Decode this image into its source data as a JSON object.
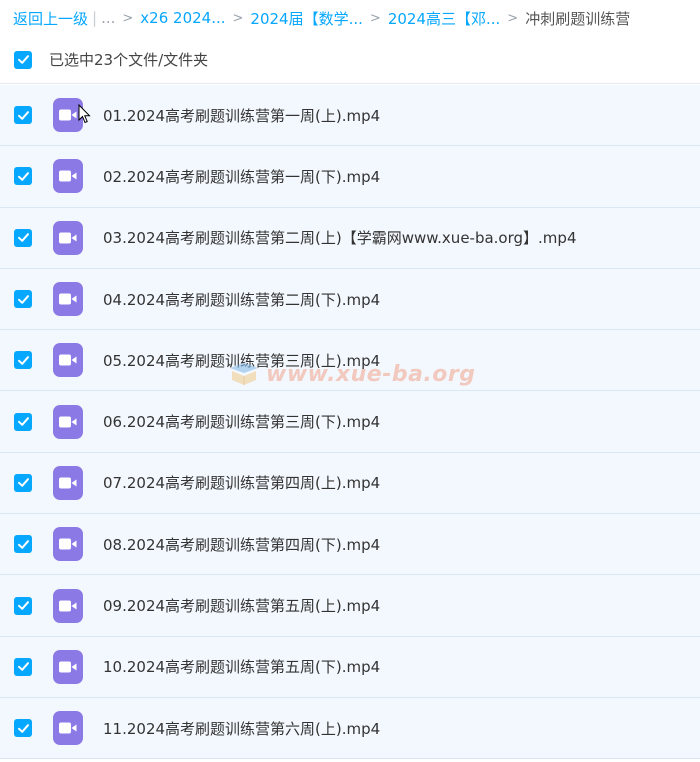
{
  "breadcrumb": {
    "back_label": "返回上一级",
    "divider": "|",
    "ellipsis": "...",
    "separator": ">",
    "items": [
      {
        "label": "x26 2024..."
      },
      {
        "label": "2024届【数学..."
      },
      {
        "label": "2024高三【邓..."
      }
    ],
    "current": "冲刺刷题训练营"
  },
  "selection": {
    "label": "已选中23个文件/文件夹",
    "checked": true
  },
  "files": [
    {
      "name": "01.2024高考刷题训练营第一周(上).mp4",
      "checked": true
    },
    {
      "name": "02.2024高考刷题训练营第一周(下).mp4",
      "checked": true
    },
    {
      "name": "03.2024高考刷题训练营第二周(上)【学霸网www.xue-ba.org】.mp4",
      "checked": true
    },
    {
      "name": "04.2024高考刷题训练营第二周(下).mp4",
      "checked": true
    },
    {
      "name": "05.2024高考刷题训练营第三周(上).mp4",
      "checked": true
    },
    {
      "name": "06.2024高考刷题训练营第三周(下).mp4",
      "checked": true
    },
    {
      "name": "07.2024高考刷题训练营第四周(上).mp4",
      "checked": true
    },
    {
      "name": "08.2024高考刷题训练营第四周(下).mp4",
      "checked": true
    },
    {
      "name": "09.2024高考刷题训练营第五周(上).mp4",
      "checked": true
    },
    {
      "name": "10.2024高考刷题训练营第五周(下).mp4",
      "checked": true
    },
    {
      "name": "11.2024高考刷题训练营第六周(上).mp4",
      "checked": true
    }
  ],
  "watermark": {
    "text": "www.xue-ba.org"
  },
  "colors": {
    "accent": "#06a7ff",
    "video_icon": "#8b79e6",
    "row_bg": "#f3f8fe"
  }
}
